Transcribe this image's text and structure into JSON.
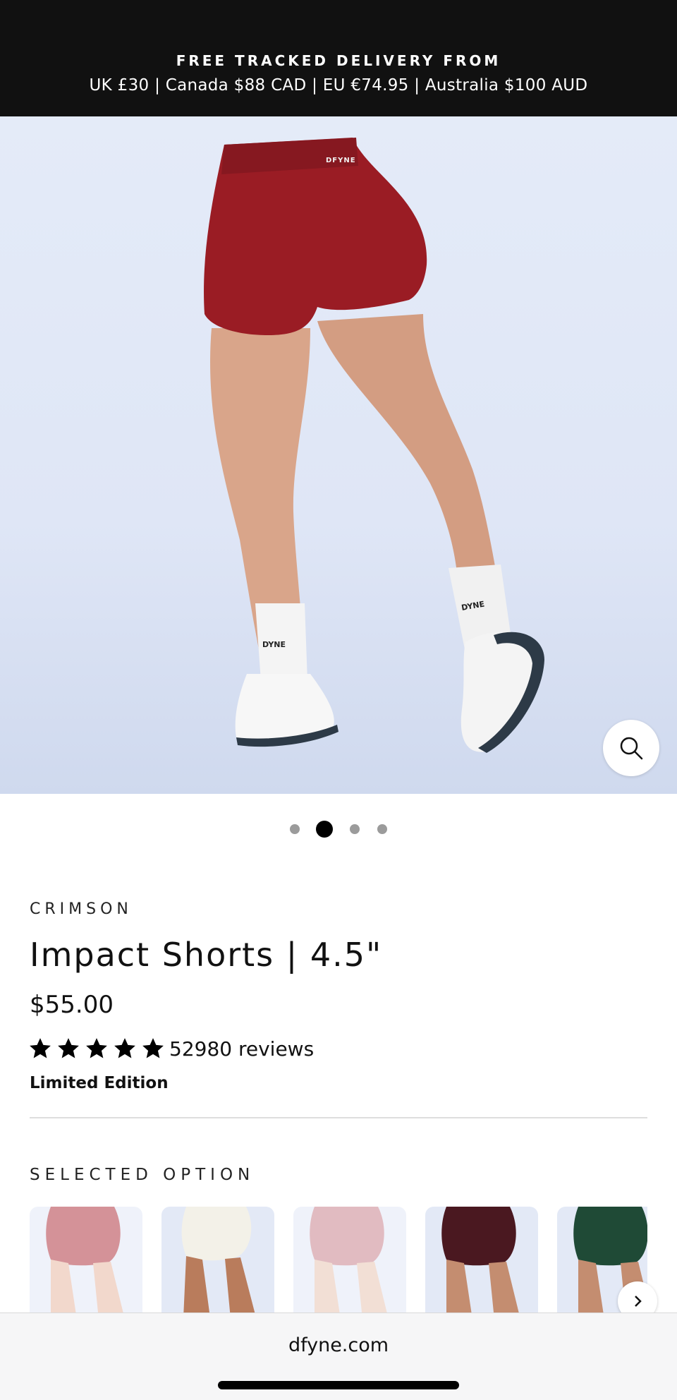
{
  "announcement": {
    "line1": "FREE TRACKED DELIVERY FROM",
    "line2": "UK £30 | Canada $88 CAD | EU €74.95 | Australia $100 AUD"
  },
  "gallery": {
    "image_icon": "product-photo",
    "zoom_icon": "search-icon",
    "slide_count": 4,
    "active_slide": 2
  },
  "product": {
    "variant": "CRIMSON",
    "title": "Impact Shorts | 4.5\"",
    "price": "$55.00",
    "rating": 5,
    "reviews": "52980 reviews",
    "edition": "Limited Edition"
  },
  "options": {
    "label": "SELECTED OPTION",
    "swatches": [
      {
        "name": "crimson",
        "color": "#b23a44"
      },
      {
        "name": "ivory",
        "color": "#f3f1e8"
      },
      {
        "name": "rose",
        "color": "#c9848f"
      },
      {
        "name": "plum",
        "color": "#4a1820"
      },
      {
        "name": "forest-green",
        "color": "#1f4a36"
      }
    ],
    "next_icon": "chevron-right-icon"
  },
  "browser": {
    "url": "dfyne.com"
  },
  "colors": {
    "announcement_bg": "#111111",
    "shorts": "#9a1c24",
    "image_bg": "#e2e9f7"
  }
}
